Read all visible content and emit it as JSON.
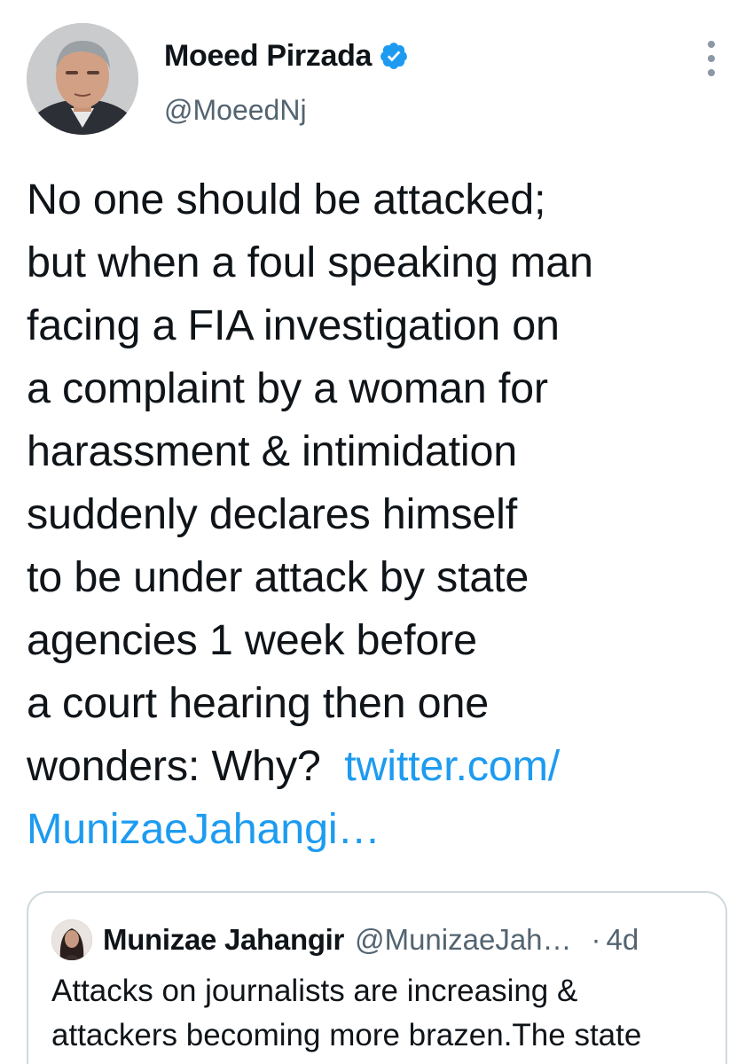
{
  "author": {
    "display_name": "Moeed Pirzada",
    "handle": "@MoeedNj",
    "verified_icon": "verified-badge-icon",
    "more_icon": "more-options-icon"
  },
  "tweet": {
    "text": "No one should be attacked;\nbut when a foul speaking man\nfacing a FIA investigation on\na complaint by a woman for\nharassment & intimidation\nsuddenly declares himself\nto be under attack by state\nagencies 1 week before\na court hearing then one\nwonders: Why?  ",
    "link_text": "twitter.com/\nMunizaeJahangi…"
  },
  "quoted_tweet": {
    "display_name": "Munizae Jahangir",
    "handle": "@MunizaeJah…",
    "separator": "·",
    "time": "4d",
    "text": "Attacks on journalists are increasing &\nattackers becoming more brazen.The state"
  },
  "colors": {
    "link": "#1d9bf0",
    "verified": "#1d9bf0",
    "secondary_text": "#536471",
    "primary_text": "#0f1419",
    "border": "#cfd9de"
  }
}
